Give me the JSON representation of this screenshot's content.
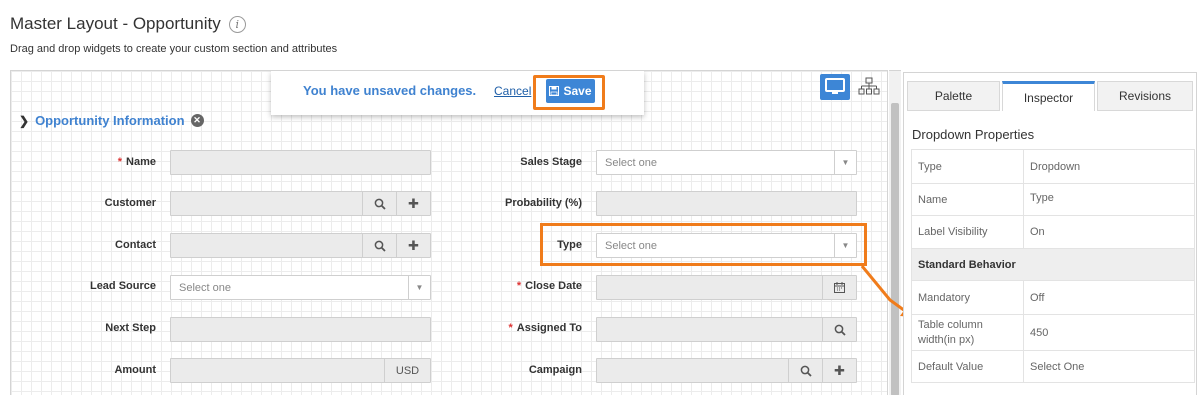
{
  "header": {
    "title": "Master Layout - Opportunity",
    "subtitle": "Drag and drop widgets to create your custom section and attributes"
  },
  "unsaved_bar": {
    "message": "You have unsaved changes.",
    "cancel_label": "Cancel",
    "save_label": "Save"
  },
  "section": {
    "title": "Opportunity Information"
  },
  "fields_left": [
    {
      "label": "Name",
      "required": true,
      "kind": "text",
      "value": ""
    },
    {
      "label": "Customer",
      "required": false,
      "kind": "lookup-add",
      "value": ""
    },
    {
      "label": "Contact",
      "required": false,
      "kind": "lookup-add",
      "value": ""
    },
    {
      "label": "Lead Source",
      "required": false,
      "kind": "select",
      "placeholder": "Select one"
    },
    {
      "label": "Next Step",
      "required": false,
      "kind": "text",
      "value": ""
    },
    {
      "label": "Amount",
      "required": false,
      "kind": "currency",
      "suffix": "USD"
    }
  ],
  "fields_right": [
    {
      "label": "Sales Stage",
      "required": false,
      "kind": "select",
      "placeholder": "Select one"
    },
    {
      "label": "Probability (%)",
      "required": false,
      "kind": "text",
      "value": ""
    },
    {
      "label": "Type",
      "required": false,
      "kind": "select",
      "placeholder": "Select one"
    },
    {
      "label": "Close Date",
      "required": true,
      "kind": "date",
      "value": ""
    },
    {
      "label": "Assigned To",
      "required": true,
      "kind": "lookup",
      "value": ""
    },
    {
      "label": "Campaign",
      "required": false,
      "kind": "lookup-add",
      "value": ""
    }
  ],
  "panel": {
    "tabs": [
      "Palette",
      "Inspector",
      "Revisions"
    ],
    "active_tab": "Inspector",
    "title": "Dropdown Properties",
    "rows": [
      {
        "key": "Type",
        "value": "Dropdown"
      },
      {
        "key": "Name",
        "value": "Type"
      },
      {
        "key": "Label Visibility",
        "value": "On"
      },
      {
        "group": "Standard Behavior"
      },
      {
        "key": "Mandatory",
        "value": "Off"
      },
      {
        "key": "Table column width(in px)",
        "value": "450"
      },
      {
        "key": "Default Value",
        "value": "Select One"
      }
    ]
  },
  "colors": {
    "accent": "#3d86d6",
    "highlight": "#f07c1b",
    "required": "#dd3333"
  },
  "icons": {
    "info": "info-icon",
    "save": "floppy-disk-icon",
    "desktop_view": "monitor-icon",
    "tree_view": "hierarchy-icon",
    "collapse": "chevron-down-icon",
    "remove_section": "close-circle-icon",
    "lookup": "search-icon",
    "add": "plus-icon",
    "date": "calendar-icon",
    "dropdown": "caret-down-icon"
  }
}
